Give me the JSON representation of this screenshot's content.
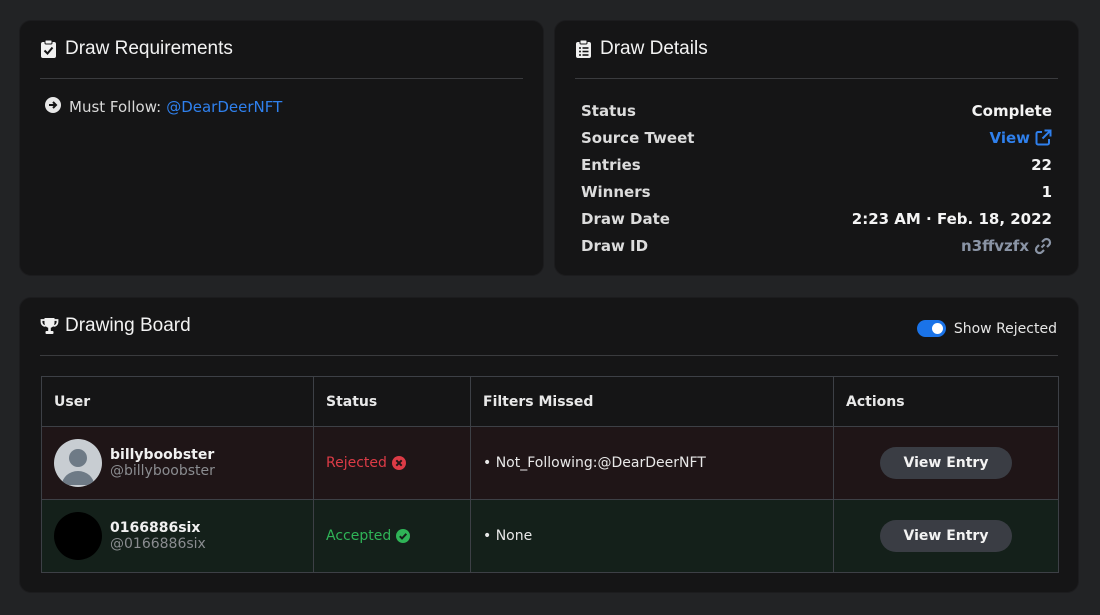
{
  "requirements": {
    "title": "Draw Requirements",
    "items": [
      {
        "label": "Must Follow:",
        "value": "@DearDeerNFT"
      }
    ]
  },
  "details": {
    "title": "Draw Details",
    "rows": [
      {
        "key": "Status",
        "value": "Complete"
      },
      {
        "key": "Source Tweet",
        "value": "View"
      },
      {
        "key": "Entries",
        "value": "22"
      },
      {
        "key": "Winners",
        "value": "1"
      },
      {
        "key": "Draw Date",
        "value": "2:23 AM · Feb. 18, 2022"
      },
      {
        "key": "Draw ID",
        "value": "n3ffvzfx"
      }
    ]
  },
  "board": {
    "title": "Drawing Board",
    "toggle_label": "Show Rejected",
    "columns": [
      "User",
      "Status",
      "Filters Missed",
      "Actions"
    ],
    "rows": [
      {
        "name": "billyboobster",
        "handle": "@billyboobster",
        "status": "Rejected",
        "filters": "• Not_Following:@DearDeerNFT",
        "action": "View Entry"
      },
      {
        "name": "0166886six",
        "handle": "@0166886six",
        "status": "Accepted",
        "filters": "• None",
        "action": "View Entry"
      }
    ]
  },
  "colors": {
    "accent": "#2f80ed",
    "rejected": "#dc3b46",
    "accepted": "#2fb457"
  }
}
